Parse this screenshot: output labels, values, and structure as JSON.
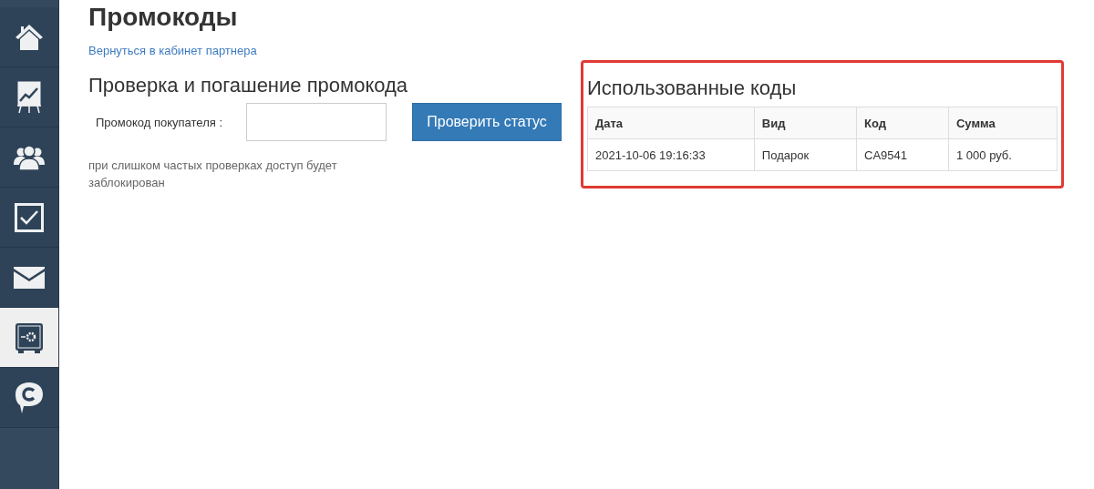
{
  "sidebar": {
    "items": [
      {
        "kind": "home",
        "selected": false
      },
      {
        "kind": "chart",
        "selected": false
      },
      {
        "kind": "users",
        "selected": false
      },
      {
        "kind": "tasks",
        "selected": false
      },
      {
        "kind": "mail",
        "selected": false
      },
      {
        "kind": "safe",
        "selected": true
      },
      {
        "kind": "chat",
        "selected": false
      }
    ]
  },
  "page_title": "Промокоды",
  "back_link": "Вернуться в кабинет партнера",
  "check_form": {
    "heading": "Проверка и погашение промокода",
    "label": "Промокод покупателя :",
    "button": "Проверить статус",
    "note": "при слишком частых проверках доступ будет заблокирован"
  },
  "used_codes": {
    "highlighted": true,
    "heading": "Использованные коды",
    "table": {
      "columns": [
        "Дата",
        "Вид",
        "Код",
        "Сумма"
      ],
      "rows": [
        [
          "2021-10-06 19:16:33",
          "Подарок",
          "CA9541",
          "1 000 руб."
        ]
      ]
    }
  }
}
